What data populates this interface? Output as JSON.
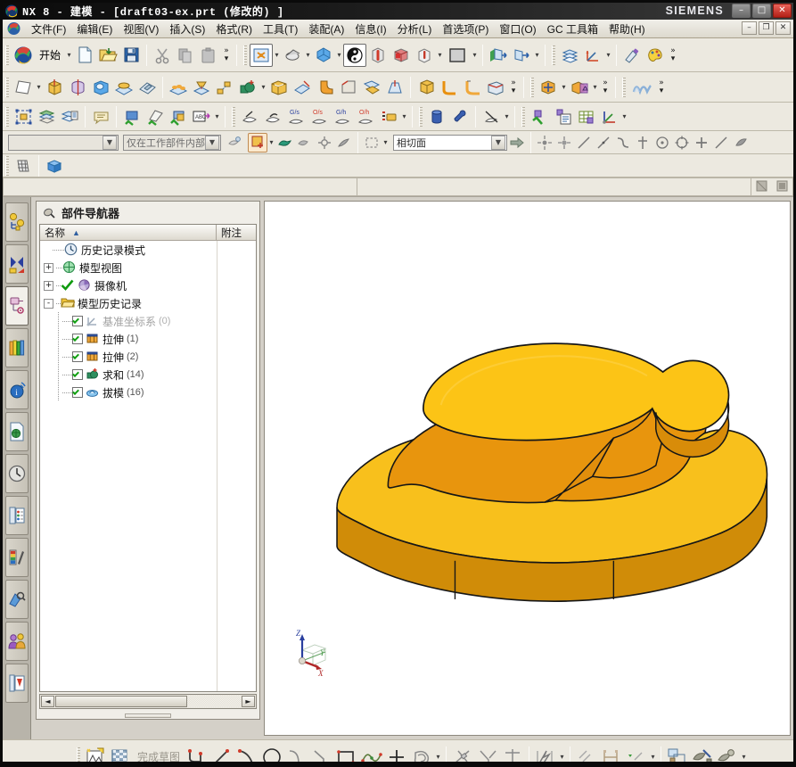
{
  "window": {
    "title": "NX 8 - 建模 - [draft03-ex.prt  (修改的)  ]",
    "brand": "SIEMENS",
    "app_icon": "nx-logo-icon",
    "controls": {
      "minimize": "–",
      "maximize": "□",
      "close": "✕"
    },
    "mdi_controls": {
      "minimize": "–",
      "restore": "❐",
      "close": "✕"
    }
  },
  "menubar": {
    "icon": "nx-start-icon",
    "items": [
      {
        "label": "文件(F)",
        "name": "menu-file"
      },
      {
        "label": "编辑(E)",
        "name": "menu-edit"
      },
      {
        "label": "视图(V)",
        "name": "menu-view"
      },
      {
        "label": "插入(S)",
        "name": "menu-insert"
      },
      {
        "label": "格式(R)",
        "name": "menu-format"
      },
      {
        "label": "工具(T)",
        "name": "menu-tools"
      },
      {
        "label": "装配(A)",
        "name": "menu-assemblies"
      },
      {
        "label": "信息(I)",
        "name": "menu-information"
      },
      {
        "label": "分析(L)",
        "name": "menu-analysis"
      },
      {
        "label": "首选项(P)",
        "name": "menu-preferences"
      },
      {
        "label": "窗口(O)",
        "name": "menu-window"
      },
      {
        "label": "GC 工具箱",
        "name": "menu-gc-toolbox"
      },
      {
        "label": "帮助(H)",
        "name": "menu-help"
      }
    ]
  },
  "toolbar_standard": {
    "start_label": "开始",
    "buttons": [
      "start-menu-button",
      "new-file-icon",
      "open-file-icon",
      "save-icon",
      "cut-icon",
      "copy-icon",
      "paste-icon",
      "fit-view-icon",
      "zoom-icon",
      "rotate-view-icon",
      "shaded-with-edges-icon",
      "true-shading-icon",
      "studio-render-icon",
      "perspective-icon",
      "background-color-icon",
      "clip-plane-icon",
      "section-icon",
      "layer-settings-icon",
      "wcs-dynamics-icon",
      "material-icon",
      "visual-icon"
    ]
  },
  "toolbar_feature": {
    "buttons": [
      "sketch-icon",
      "extrude-icon",
      "revolve-icon",
      "hole-icon",
      "boss-icon",
      "pocket-icon",
      "pad-icon",
      "groove-icon",
      "pattern-face-icon",
      "unite-icon",
      "shell-icon",
      "trim-body-icon",
      "edge-blend-icon",
      "chamfer-icon",
      "face-blend-icon",
      "draft-icon",
      "thread-icon",
      "offset-face-icon",
      "taper-icon",
      "sew-icon",
      "move-object-icon",
      "mirror-feature-icon",
      "through-curves-icon"
    ]
  },
  "toolbar_utility": {
    "buttons": [
      "feature-group-icon",
      "layer-icon",
      "layer-category-icon",
      "note-icon",
      "datum-plane-check-icon",
      "datum-axis-check-icon",
      "datum-csys-check-icon",
      "annotation-icon",
      "geometric-tol-a-icon",
      "geometric-tol-b-icon",
      "gs-icon",
      "os-icon",
      "gh-icon",
      "oh-icon",
      "expression-icon",
      "cylinder-icon",
      "pin-icon",
      "measure-icon",
      "check-mate-icon",
      "requirement-icon",
      "spreadsheet-icon",
      "csys-icon"
    ]
  },
  "selection_bar": {
    "type_filter_value": "",
    "scope_value": "仅在工作部件内部",
    "tangent_value": "相切面",
    "icons": [
      "select-general-icon",
      "select-face-icon",
      "select-body-icon",
      "select-feature-icon",
      "select-component-icon",
      "rect-select-icon",
      "snap-point-icon",
      "point-on-curve-icon",
      "endpoint-icon",
      "midpoint-icon",
      "arc-center-icon",
      "quadrant-icon",
      "intersection-icon",
      "tangent-point-icon",
      "face-point-icon"
    ]
  },
  "tab_strip": {
    "icons": [
      "grid-view-icon",
      "isometric-view-icon"
    ]
  },
  "status_line": {
    "cue_left": "",
    "cue_mid": "",
    "indicators": [
      "view-indicator-icon",
      "render-indicator-icon"
    ]
  },
  "resource_bar": {
    "items": [
      {
        "name": "assembly-navigator-icon",
        "label": "装配导航器"
      },
      {
        "name": "constraint-navigator-icon",
        "label": "约束导航器"
      },
      {
        "name": "part-navigator-icon",
        "label": "部件导航器",
        "active": true
      },
      {
        "name": "reuse-library-icon",
        "label": "重用库"
      },
      {
        "name": "internet-explorer-icon",
        "label": "Internet Explorer"
      },
      {
        "name": "html-help-icon",
        "label": "HTML 帮助"
      },
      {
        "name": "history-icon",
        "label": "历史记录"
      },
      {
        "name": "system-scenes-icon",
        "label": "系统场景"
      },
      {
        "name": "system-materials-icon",
        "label": "系统材料"
      },
      {
        "name": "system-visual-icon",
        "label": "系统视觉效果"
      },
      {
        "name": "roles-icon",
        "label": "角色"
      },
      {
        "name": "web-browser-icon",
        "label": "Web 浏览器"
      }
    ]
  },
  "part_navigator": {
    "title": "部件导航器",
    "pin_icon": "pin-icon",
    "columns": [
      {
        "label": "名称",
        "name": "column-name"
      },
      {
        "label": "附注",
        "name": "column-comment"
      }
    ],
    "sort_arrow": "▲",
    "rows": [
      {
        "depth": 0,
        "expander": "",
        "check": false,
        "icon": "clock-icon",
        "label": "历史记录模式",
        "count": "",
        "dim": false
      },
      {
        "depth": 0,
        "expander": "+",
        "check": false,
        "icon": "model-views-icon",
        "label": "模型视图",
        "count": "",
        "dim": false
      },
      {
        "depth": 0,
        "expander": "+",
        "check": false,
        "icon": "camera-icon",
        "label": "摄像机",
        "count": "",
        "dim": false,
        "greencheck": true
      },
      {
        "depth": 0,
        "expander": "-",
        "check": false,
        "icon": "folder-icon",
        "label": "模型历史记录",
        "count": "",
        "dim": false
      },
      {
        "depth": 1,
        "expander": "",
        "check": true,
        "icon": "datum-csys-icon",
        "label": "基准坐标系",
        "count": "(0)",
        "dim": true
      },
      {
        "depth": 1,
        "expander": "",
        "check": true,
        "icon": "extrude-icon",
        "label": "拉伸",
        "count": "(1)",
        "dim": false
      },
      {
        "depth": 1,
        "expander": "",
        "check": true,
        "icon": "extrude-icon",
        "label": "拉伸",
        "count": "(2)",
        "dim": false
      },
      {
        "depth": 1,
        "expander": "",
        "check": true,
        "icon": "unite-icon",
        "label": "求和",
        "count": "(14)",
        "dim": false
      },
      {
        "depth": 1,
        "expander": "",
        "check": true,
        "icon": "draft-icon",
        "label": "拔模",
        "count": "(16)",
        "dim": false
      }
    ],
    "hscroll": {
      "left_arrow": "◄",
      "right_arrow": "►"
    }
  },
  "viewport": {
    "background": "#ffffff",
    "model": {
      "name": "draft03-ex",
      "face_top_color": "#fcc416",
      "face_side_color": "#e8950d",
      "face_dark_color": "#c87f08",
      "edge_color": "#1a1a1a"
    },
    "triad": {
      "axis_z_label": "Z",
      "axis_y_label": "Y",
      "axis_x_label": "X",
      "z_color": "#2a3f9e",
      "y_color": "#3f8f3f",
      "x_color": "#b02828"
    }
  },
  "bottom_toolbar": {
    "finish_sketch_label": "完成草图",
    "buttons": [
      "sketch-in-task-icon",
      "finish-sketch-icon",
      "profile-icon",
      "line-icon",
      "arc-icon",
      "circle-icon",
      "fillet-icon",
      "chamfer-icon",
      "rectangle-icon",
      "studio-spline-icon",
      "point-icon",
      "offset-curve-icon",
      "quick-trim-icon",
      "quick-extend-icon",
      "make-corner-icon",
      "constraints-icon",
      "auto-dim-icon",
      "inferred-dim-icon",
      "constraint-display-icon",
      "edit-defining-section-icon",
      "reattach-icon",
      "orient-view-icon"
    ]
  }
}
